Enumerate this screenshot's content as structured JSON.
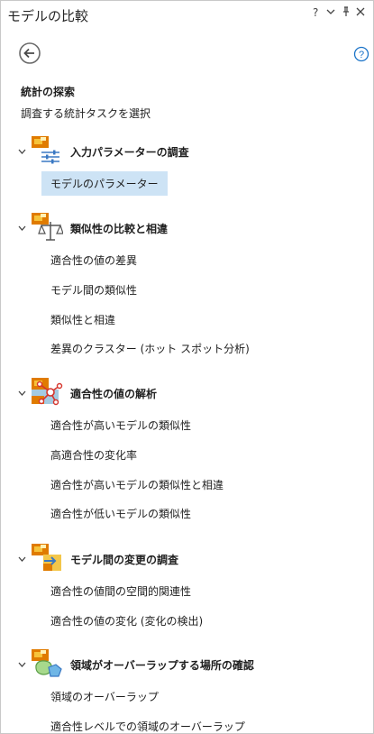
{
  "window": {
    "title": "モデルの比較",
    "controls": {
      "help": "?",
      "menu": "⌄",
      "pin": "📌",
      "close": "✕"
    }
  },
  "nav": {
    "back_icon": "back-arrow-icon",
    "help_icon": "help-circle-icon"
  },
  "section": {
    "heading": "統計の探索",
    "subheading": "調査する統計タスクを選択"
  },
  "groups": [
    {
      "title": "入力パラメーターの調査",
      "icon": "sliders-icon",
      "items": [
        {
          "label": "モデルのパラメーター",
          "selected": true
        }
      ]
    },
    {
      "title": "類似性の比較と相違",
      "icon": "balance-scale-icon",
      "items": [
        {
          "label": "適合性の値の差異"
        },
        {
          "label": "モデル間の類似性"
        },
        {
          "label": "類似性と相違"
        },
        {
          "label": "差異のクラスター (ホット スポット分析)"
        }
      ]
    },
    {
      "title": "適合性の値の解析",
      "icon": "network-graph-icon",
      "items": [
        {
          "label": "適合性が高いモデルの類似性"
        },
        {
          "label": "高適合性の変化率"
        },
        {
          "label": "適合性が高いモデルの類似性と相違"
        },
        {
          "label": "適合性が低いモデルの類似性"
        }
      ]
    },
    {
      "title": "モデル間の変更の調査",
      "icon": "change-arrow-icon",
      "items": [
        {
          "label": "適合性の値間の空間的関連性"
        },
        {
          "label": "適合性の値の変化 (変化の検出)"
        }
      ]
    },
    {
      "title": "領域がオーバーラップする場所の確認",
      "icon": "overlap-icon",
      "items": [
        {
          "label": "領域のオーバーラップ"
        },
        {
          "label": "適合性レベルでの領域のオーバーラップ"
        }
      ]
    }
  ],
  "colors": {
    "selection": "#cde3f5",
    "accent": "#1a73c8",
    "raster_orange": "#e07b00"
  }
}
